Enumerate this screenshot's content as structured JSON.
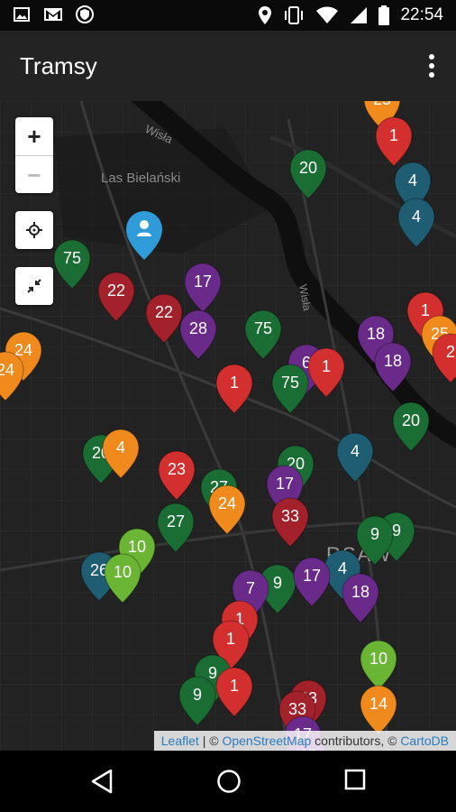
{
  "status_bar": {
    "time": "22:54",
    "left_icons": [
      "image-icon",
      "gmail-icon",
      "shield-icon"
    ],
    "right_icons": [
      "location-icon",
      "vibrate-icon",
      "wifi-icon",
      "signal-icon",
      "battery-icon"
    ]
  },
  "app_bar": {
    "title": "Tramsy",
    "menu_icon": "more-vert-icon"
  },
  "map": {
    "labels": {
      "forest": "Las Bielański",
      "river1": "Wisła",
      "river2": "Wisła",
      "district": "RSAW"
    },
    "controls": {
      "zoom_in": "+",
      "zoom_out": "−",
      "locate_icon": "crosshair-icon",
      "collapse_icon": "collapse-arrows-icon"
    },
    "attribution": {
      "leaflet": "Leaflet",
      "sep": " | © ",
      "osm": "OpenStreetMap",
      "contrib": " contributors, © ",
      "carto": "CartoDB"
    },
    "colors": {
      "red": "#d32f2f",
      "green": "#1b6e33",
      "lightgreen": "#6ab534",
      "purple": "#6a2a8a",
      "blue": "#1f5d73",
      "orange": "#f08a1c",
      "darkred": "#a3212a",
      "user": "#2f9bd8"
    },
    "markers": [
      {
        "label": "25",
        "color": "orange"
      },
      {
        "label": "1",
        "color": "red"
      },
      {
        "label": "20",
        "color": "green"
      },
      {
        "label": "4",
        "color": "blue"
      },
      {
        "label": "4",
        "color": "blue"
      },
      {
        "label": "75",
        "color": "green"
      },
      {
        "label": "22",
        "color": "darkred"
      },
      {
        "label": "17",
        "color": "purple"
      },
      {
        "label": "22",
        "color": "darkred"
      },
      {
        "label": "28",
        "color": "purple"
      },
      {
        "label": "75",
        "color": "green"
      },
      {
        "label": "18",
        "color": "purple"
      },
      {
        "label": "1",
        "color": "red"
      },
      {
        "label": "25",
        "color": "orange"
      },
      {
        "label": "24",
        "color": "orange"
      },
      {
        "label": "24",
        "color": "orange"
      },
      {
        "label": "6",
        "color": "purple"
      },
      {
        "label": "1",
        "color": "red"
      },
      {
        "label": "18",
        "color": "purple"
      },
      {
        "label": "2",
        "color": "red"
      },
      {
        "label": "1",
        "color": "red"
      },
      {
        "label": "75",
        "color": "green"
      },
      {
        "label": "20",
        "color": "green"
      },
      {
        "label": "4",
        "color": "blue"
      },
      {
        "label": "20",
        "color": "green"
      },
      {
        "label": "4",
        "color": "orange"
      },
      {
        "label": "23",
        "color": "red"
      },
      {
        "label": "20",
        "color": "green"
      },
      {
        "label": "17",
        "color": "purple"
      },
      {
        "label": "27",
        "color": "green"
      },
      {
        "label": "24",
        "color": "orange"
      },
      {
        "label": "27",
        "color": "green"
      },
      {
        "label": "33",
        "color": "darkred"
      },
      {
        "label": "9",
        "color": "green"
      },
      {
        "label": "9",
        "color": "green"
      },
      {
        "label": "4",
        "color": "blue"
      },
      {
        "label": "26",
        "color": "blue"
      },
      {
        "label": "10",
        "color": "lightgreen"
      },
      {
        "label": "10",
        "color": "lightgreen"
      },
      {
        "label": "9",
        "color": "green"
      },
      {
        "label": "17",
        "color": "purple"
      },
      {
        "label": "18",
        "color": "purple"
      },
      {
        "label": "7",
        "color": "purple"
      },
      {
        "label": "1",
        "color": "red"
      },
      {
        "label": "1",
        "color": "red"
      },
      {
        "label": "10",
        "color": "lightgreen"
      },
      {
        "label": "9",
        "color": "green"
      },
      {
        "label": "1",
        "color": "red"
      },
      {
        "label": "14",
        "color": "orange"
      },
      {
        "label": "9",
        "color": "green"
      },
      {
        "label": "33",
        "color": "darkred"
      },
      {
        "label": "33",
        "color": "darkred"
      },
      {
        "label": "17",
        "color": "purple"
      },
      {
        "label": "17",
        "color": "purple"
      }
    ]
  },
  "nav_bar": {
    "back_icon": "back-triangle-icon",
    "home_icon": "home-circle-icon",
    "recents_icon": "recents-square-icon"
  }
}
